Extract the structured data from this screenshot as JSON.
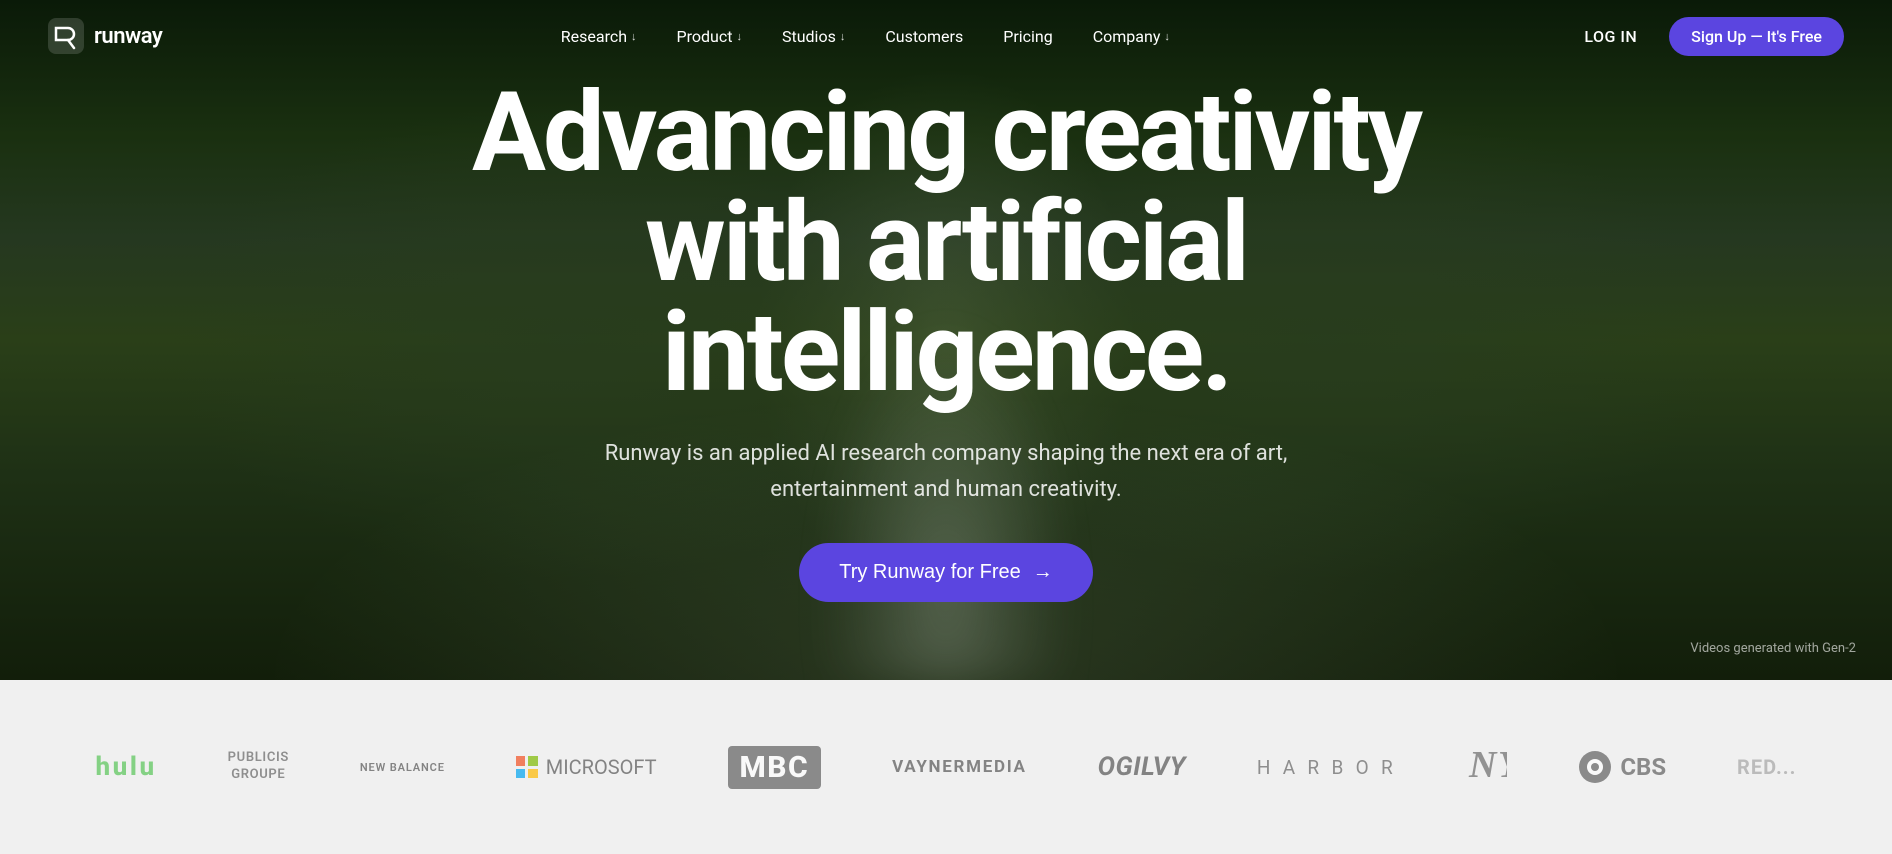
{
  "nav": {
    "logo_text": "runway",
    "items": [
      {
        "id": "research",
        "label": "Research",
        "has_dropdown": true
      },
      {
        "id": "product",
        "label": "Product",
        "has_dropdown": true
      },
      {
        "id": "studios",
        "label": "Studios",
        "has_dropdown": true
      },
      {
        "id": "customers",
        "label": "Customers",
        "has_dropdown": false
      },
      {
        "id": "pricing",
        "label": "Pricing",
        "has_dropdown": false
      },
      {
        "id": "company",
        "label": "Company",
        "has_dropdown": true
      }
    ],
    "login_label": "LOG IN",
    "signup_label": "Sign Up — It's Free"
  },
  "hero": {
    "title_line1": "Advancing creativity",
    "title_line2": "with artificial intelligence.",
    "subtitle": "Runway is an applied AI research company shaping the next era of art, entertainment and human creativity.",
    "cta_label": "Try Runway for Free",
    "cta_arrow": "→",
    "video_credit": "Videos generated with Gen-2"
  },
  "logos": [
    {
      "id": "hulu",
      "text": "hulu",
      "style": "hulu"
    },
    {
      "id": "publicis",
      "text": "PUBLICIS GROUPE",
      "style": "default"
    },
    {
      "id": "new-balance",
      "text": "new balance",
      "style": "nb"
    },
    {
      "id": "microsoft",
      "text": "Microsoft",
      "style": "microsoft"
    },
    {
      "id": "mbc",
      "text": "MBC",
      "style": "mbc"
    },
    {
      "id": "vaynermedia",
      "text": "VAYNERMEDIA",
      "style": "default"
    },
    {
      "id": "ogilvy",
      "text": "Ogilvy",
      "style": "ogilvy"
    },
    {
      "id": "harbor",
      "text": "HARBOR",
      "style": "harbor"
    },
    {
      "id": "yankees",
      "text": "NY",
      "style": "yankees"
    },
    {
      "id": "cbs",
      "text": "CBS",
      "style": "cbs"
    },
    {
      "id": "red-etc",
      "text": "RED...",
      "style": "partial"
    }
  ],
  "colors": {
    "accent": "#5B45E0",
    "nav_bg": "transparent",
    "hero_bg": "#1a2a1a",
    "logos_bg": "#f0f0f0"
  }
}
